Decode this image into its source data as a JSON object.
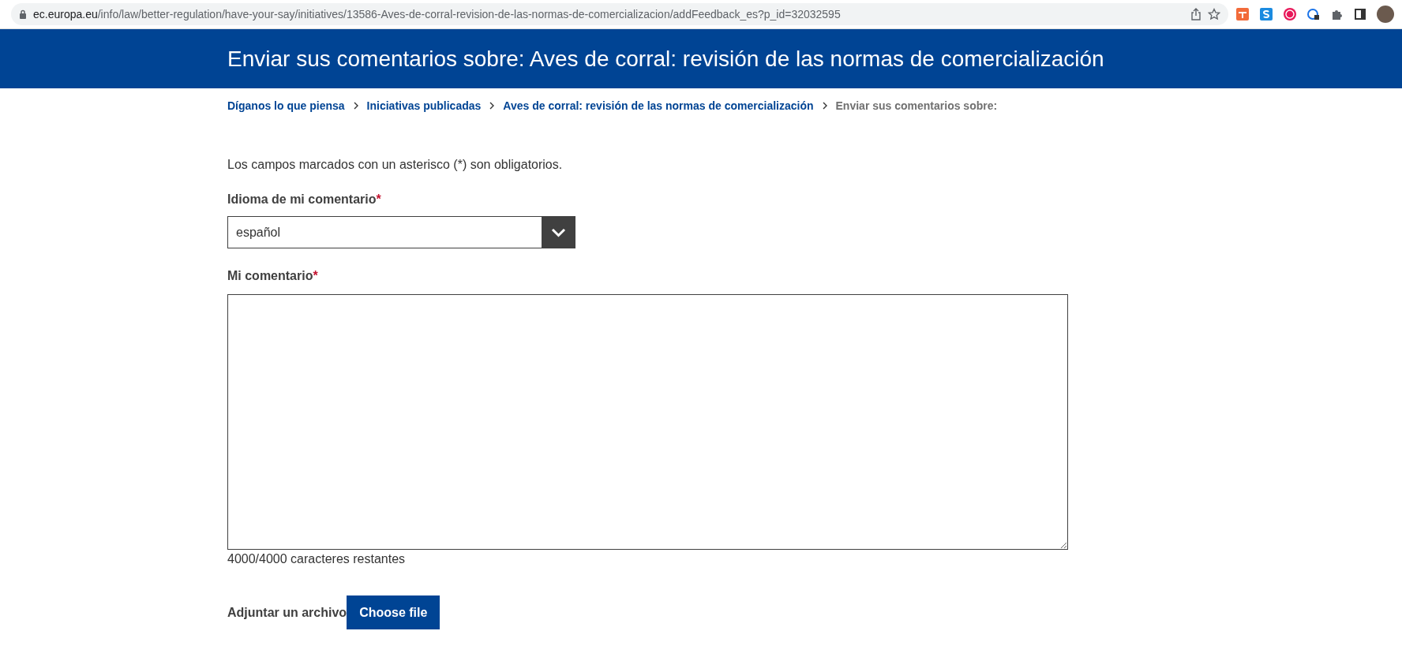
{
  "browser": {
    "url_host": "ec.europa.eu",
    "url_path": "/info/law/better-regulation/have-your-say/initiatives/13586-Aves-de-corral-revision-de-las-normas-de-comercializacion/addFeedback_es?p_id=32032595"
  },
  "header": {
    "title": "Enviar sus comentarios sobre: Aves de corral: revisión de las normas de comercialización"
  },
  "breadcrumb": [
    {
      "label": "Díganos lo que piensa",
      "kind": "link"
    },
    {
      "label": "Iniciativas publicadas",
      "kind": "link"
    },
    {
      "label": "Aves de corral: revisión de las normas de comercialización",
      "kind": "link"
    },
    {
      "label": "Enviar sus comentarios sobre:",
      "kind": "current"
    }
  ],
  "form": {
    "required_note": "Los campos marcados con un asterisco (*) son obligatorios.",
    "language": {
      "label": "Idioma de mi comentario",
      "required_mark": "*",
      "value": "español"
    },
    "comment": {
      "label": "Mi comentario",
      "required_mark": "*",
      "counter": "4000/4000 caracteres restantes"
    },
    "attachment": {
      "label": "Adjuntar un archivo",
      "button": "Choose file"
    }
  }
}
